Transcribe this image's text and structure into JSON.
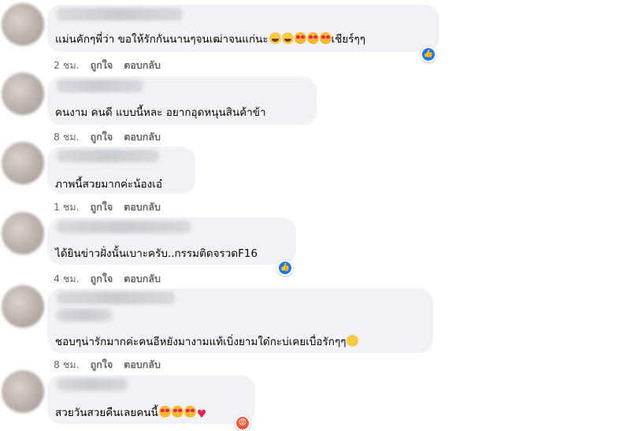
{
  "comments": [
    {
      "text": "แม่นคักๆพี่ว่า ขอให้รักกันนานๆจนเฒ่าจนแก่นะ",
      "emoji_after": [
        "laugh",
        "laugh",
        "heart-eyes",
        "heart-eyes",
        "heart-eyes"
      ],
      "text_after": "เชียร์ๆๆ",
      "time": "2 ชม.",
      "like": "ถูกใจ",
      "reply": "ตอบกลับ",
      "reaction": "like-icon"
    },
    {
      "text": "คนงาม คนดี แบบนี้หละ อยากอุดหนุนสินค้าข้า",
      "time": "8 ชม.",
      "like": "ถูกใจ",
      "reply": "ตอบกลับ"
    },
    {
      "text": "ภาพนี้สวยมากค่ะน้องเอ๋",
      "time": "1 ชม.",
      "like": "ถูกใจ",
      "reply": "ตอบกลับ"
    },
    {
      "text": "ได้ยินข่าวฝั่งนั้นเบาะครับ..กรรมติดจรวดF16",
      "time": "4 ชม.",
      "like": "ถูกใจ",
      "reply": "ตอบกลับ",
      "reaction": "like-icon"
    },
    {
      "text": "ชอบๆน่ารักมากค่ะคนอีหยังมางามแท้เบิ่งยามใด๋กะบ่เคยเบื่อรักๆๆ",
      "emoji_after": [
        "kiss"
      ],
      "time": "8 ชม.",
      "like": "ถูกใจ",
      "reply": "ตอบกลับ"
    },
    {
      "text": "สวยวันสวยคืนเลยคนนี้",
      "emoji_after": [
        "heart-eyes",
        "heart-eyes",
        "heart-eyes",
        "red-heart"
      ],
      "reaction": "angry-icon"
    }
  ],
  "colors": {
    "bubble": "#f0f2f5",
    "meta": "#65676b",
    "like_blue": "#1877f2"
  }
}
